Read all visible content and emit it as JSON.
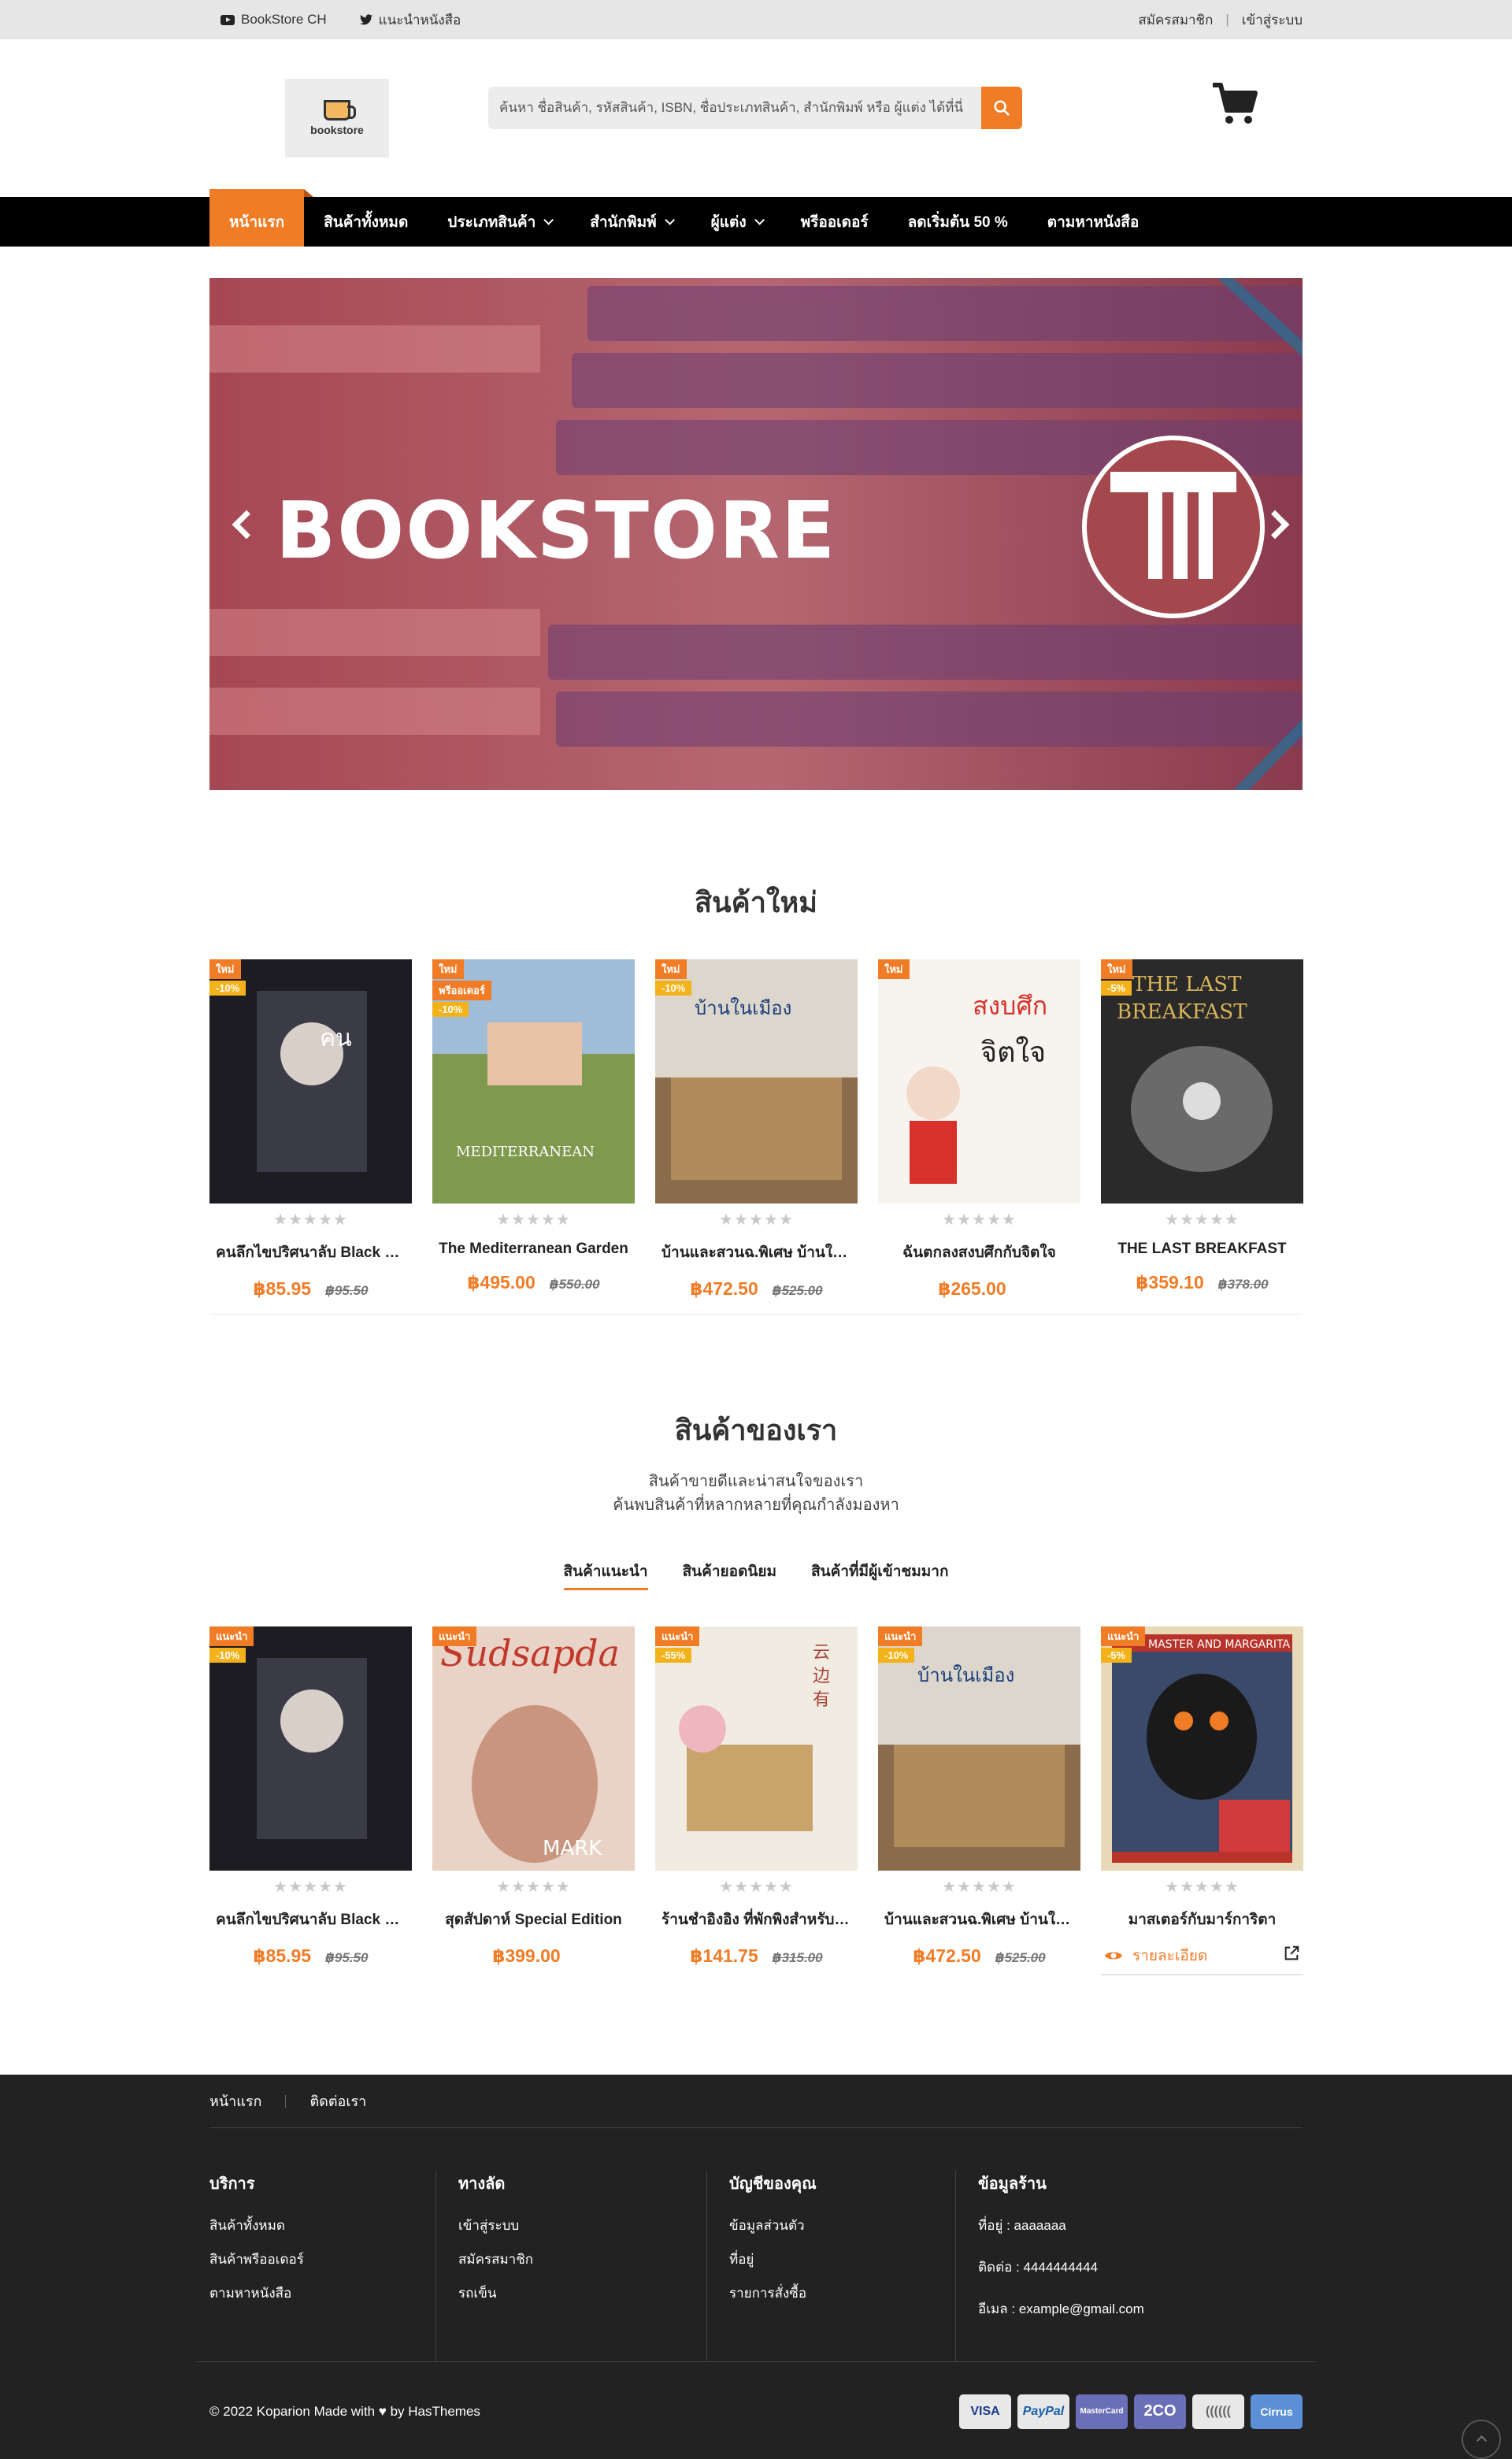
{
  "topbar": {
    "left_links": [
      {
        "label": "BookStore CH",
        "icon": "youtube-icon"
      },
      {
        "label": "แนะนำหนังสือ",
        "icon": "twitter-icon"
      }
    ],
    "register": "สมัครสมาชิก",
    "separator": "|",
    "login": "เข้าสู่ระบบ"
  },
  "header": {
    "logo_text": "bookstore",
    "search_placeholder": "ค้นหา ชื่อสินค้า, รหัสสินค้า, ISBN, ชื่อประเภทสินค้า, สำนักพิมพ์ หรือ ผู้แต่ง ได้ที่นี่"
  },
  "nav": {
    "items": [
      {
        "label": "หน้าแรก",
        "dropdown": false,
        "active": true
      },
      {
        "label": "สินค้าทั้งหมด",
        "dropdown": false
      },
      {
        "label": "ประเภทสินค้า",
        "dropdown": true
      },
      {
        "label": "สำนักพิมพ์",
        "dropdown": true
      },
      {
        "label": "ผู้แต่ง",
        "dropdown": true
      },
      {
        "label": "พรีออเดอร์",
        "dropdown": false
      },
      {
        "label": "ลดเริ่มต้น 50 %",
        "dropdown": false
      },
      {
        "label": "ตามหาหนังสือ",
        "dropdown": false
      }
    ]
  },
  "banner": {
    "title": "BOOKSTORE"
  },
  "new_products": {
    "title": "สินค้าใหม่",
    "items": [
      {
        "badges": [
          "ใหม่",
          "-10%"
        ],
        "name": "คนลึกไขปริศนาลับ Black Butler",
        "price": "฿85.95",
        "old": "฿95.50",
        "cover": "#1c1c22"
      },
      {
        "badges": [
          "ใหม่",
          "พรีออเดอร์",
          "-10%"
        ],
        "name": "The Mediterranean Garden",
        "price": "฿495.00",
        "old": "฿550.00",
        "cover": "#8fa76a"
      },
      {
        "badges": [
          "ใหม่",
          "-10%"
        ],
        "name": "บ้านและสวนฉ.พิเศษ บ้านในเมือง",
        "price": "฿472.50",
        "old": "฿525.00",
        "cover": "#a89a84"
      },
      {
        "badges": [
          "ใหม่"
        ],
        "name": "ฉันตกลงสงบศึกกับจิตใจ",
        "price": "฿265.00",
        "old": "",
        "cover": "#f7f4ef"
      },
      {
        "badges": [
          "ใหม่",
          "-5%"
        ],
        "name": "THE LAST BREAKFAST",
        "price": "฿359.10",
        "old": "฿378.00",
        "cover": "#2a2a2a"
      }
    ]
  },
  "our_products": {
    "title": "สินค้าของเรา",
    "subtitle_1": "สินค้าขายดีและน่าสนใจของเรา",
    "subtitle_2": "ค้นพบสินค้าที่หลากหลายที่คุณกำลังมองหา",
    "tabs": [
      "สินค้าแนะนำ",
      "สินค้ายอดนิยม",
      "สินค้าที่มีผู้เข้าชมมาก"
    ],
    "detail_label": "รายละเอียด",
    "items": [
      {
        "badges": [
          "แนะนำ",
          "-10%"
        ],
        "name": "คนลึกไขปริศนาลับ Black Butler",
        "price": "฿85.95",
        "old": "฿95.50",
        "cover": "#1c1c22"
      },
      {
        "badges": [
          "แนะนำ"
        ],
        "name": "สุดสัปดาห์ Special Edition",
        "price": "฿399.00",
        "old": "",
        "cover": "#d9a79a"
      },
      {
        "badges": [
          "แนะนำ",
          "-55%"
        ],
        "name": "ร้านชำอิงอิง ที่พักพิงสำหรับผู้อ่อนล้า",
        "price": "฿141.75",
        "old": "฿315.00",
        "cover": "#e8dccb"
      },
      {
        "badges": [
          "แนะนำ",
          "-10%"
        ],
        "name": "บ้านและสวนฉ.พิเศษ บ้านในเมือง",
        "price": "฿472.50",
        "old": "฿525.00",
        "cover": "#a89a84"
      },
      {
        "badges": [
          "แนะนำ",
          "-5%"
        ],
        "name": "มาสเตอร์กับมาร์การิตา",
        "price": "",
        "old": "",
        "cover": "#3b4a6a"
      }
    ]
  },
  "footer": {
    "top_links": [
      "หน้าแรก",
      "ติดต่อเรา"
    ],
    "columns": [
      {
        "title": "บริการ",
        "links": [
          "สินค้าทั้งหมด",
          "สินค้าพรีออเดอร์",
          "ตามหาหนังสือ"
        ]
      },
      {
        "title": "ทางลัด",
        "links": [
          "เข้าสู่ระบบ",
          "สมัครสมาชิก",
          "รถเข็น"
        ]
      },
      {
        "title": "บัญชีของคุณ",
        "links": [
          "ข้อมูลส่วนตัว",
          "ที่อยู่",
          "รายการสั่งซื้อ"
        ]
      },
      {
        "title": "ข้อมูลร้าน",
        "links": [
          "ที่อยู่ : aaaaaaa",
          "ติดต่อ : 4444444444",
          "อีเมล : example@gmail.com"
        ]
      }
    ],
    "copyright": "© 2022 Koparion Made with ♥ by HasThemes",
    "payments": [
      {
        "label": "VISA",
        "bg": "#e8e8e8",
        "fg": "#1a3b8f"
      },
      {
        "label": "PayPal",
        "bg": "#e8e8e8",
        "fg": "#1b5fae"
      },
      {
        "label": "MasterCard",
        "bg": "#6b6fb8",
        "fg": "#ffffff"
      },
      {
        "label": "2CO",
        "bg": "#6b6fb8",
        "fg": "#ffffff"
      },
      {
        "label": "((((((",
        "bg": "#e8e8e8",
        "fg": "#666666"
      },
      {
        "label": "Cirrus",
        "bg": "#5b8fd6",
        "fg": "#ffffff"
      }
    ]
  },
  "colors": {
    "accent": "#f07c26",
    "nav_bg": "#000000",
    "footer_bg": "#222222"
  }
}
